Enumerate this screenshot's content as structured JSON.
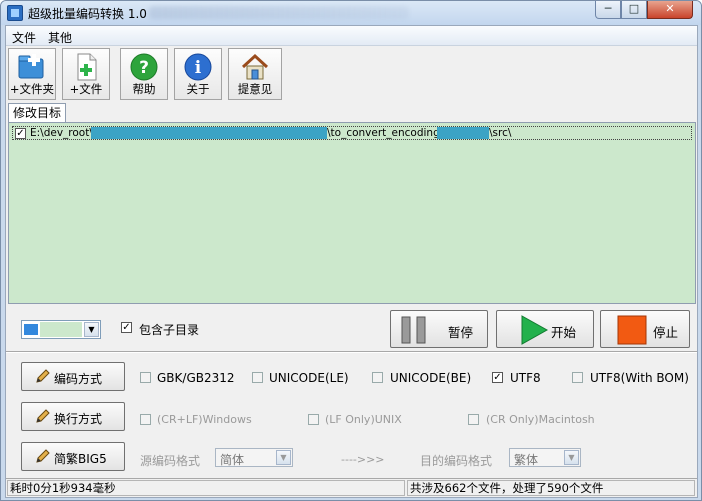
{
  "window": {
    "title": "超级批量编码转换 1.0",
    "min_glyph": "─",
    "max_glyph": "□",
    "close_glyph": "✕"
  },
  "menu": [
    "文件",
    "其他"
  ],
  "toolbar": [
    {
      "label": "+文件夹",
      "icon": "add-folder-icon"
    },
    {
      "label": "+文件",
      "icon": "add-file-icon"
    },
    {
      "label": "帮助",
      "icon": "help-icon"
    },
    {
      "label": "关于",
      "icon": "info-icon"
    },
    {
      "label": "提意见",
      "icon": "home-icon"
    }
  ],
  "tab": {
    "label": "修改目标"
  },
  "list": {
    "items": [
      {
        "checked": true,
        "path_start": "E:\\dev_root\\",
        "path_mid": "\\to_convert_encoding\\",
        "path_end": "\\src\\"
      }
    ]
  },
  "options": {
    "include_subdirs_label": "包含子目录",
    "include_subdirs_checked": true
  },
  "actions": {
    "pause": "暂停",
    "start": "开始",
    "stop": "停止"
  },
  "encoding": {
    "button": "编码方式",
    "options": [
      {
        "label": "GBK/GB2312",
        "checked": false
      },
      {
        "label": "UNICODE(LE)",
        "checked": false
      },
      {
        "label": "UNICODE(BE)",
        "checked": false
      },
      {
        "label": "UTF8",
        "checked": true
      },
      {
        "label": "UTF8(With BOM)",
        "checked": false
      }
    ]
  },
  "newline": {
    "button": "换行方式",
    "options": [
      {
        "label": "(CR+LF)Windows",
        "checked": false
      },
      {
        "label": "(LF Only)UNIX",
        "checked": false
      },
      {
        "label": "(CR Only)Macintosh",
        "checked": false
      }
    ]
  },
  "convert": {
    "button": "简繁BIG5",
    "source_label": "源编码格式",
    "source_value": "简体",
    "arrow": "---->>>",
    "target_label": "目的编码格式",
    "target_value": "繁体"
  },
  "status": {
    "elapsed": "耗时0分1秒934毫秒",
    "summary": "共涉及662个文件，处理了590个文件"
  },
  "colors": {
    "list_bg": "#cce8cc",
    "redaction": "#3ba3c5",
    "start_green": "#22b14c",
    "stop_orange": "#f25a12"
  }
}
